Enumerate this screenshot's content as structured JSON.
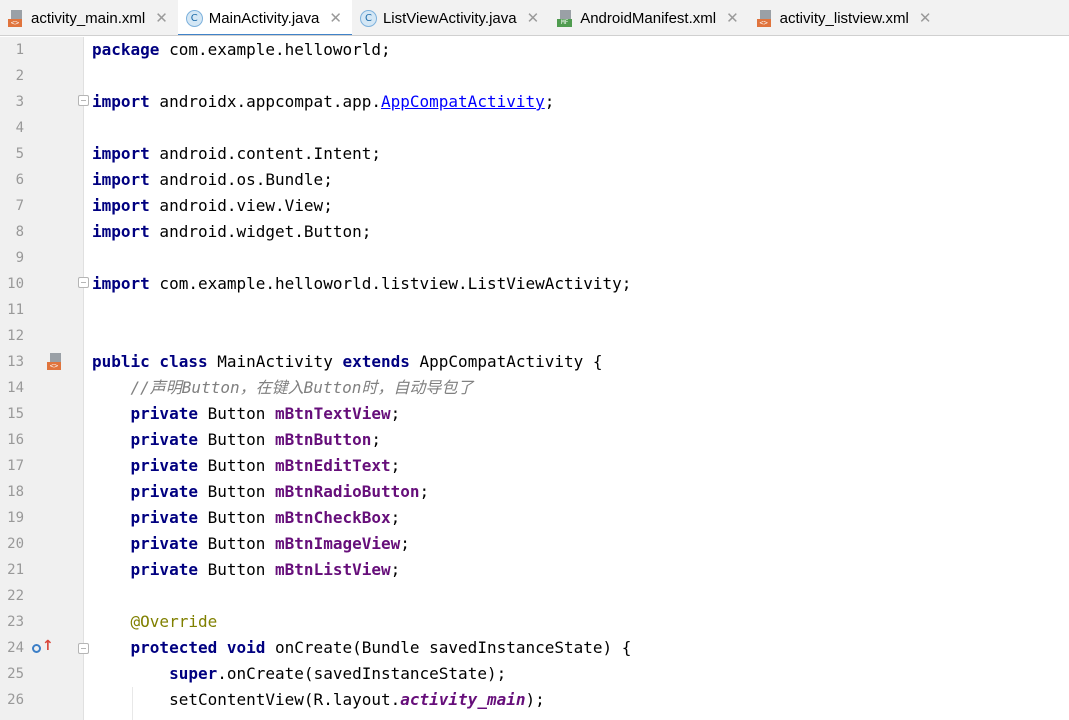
{
  "tabs": [
    {
      "label": "activity_main.xml",
      "icon": "xml-file-icon",
      "active": false
    },
    {
      "label": "MainActivity.java",
      "icon": "java-class-icon",
      "active": true
    },
    {
      "label": "ListViewActivity.java",
      "icon": "java-class-icon",
      "active": false
    },
    {
      "label": "AndroidManifest.xml",
      "icon": "manifest-file-icon",
      "active": false
    },
    {
      "label": "activity_listview.xml",
      "icon": "xml-file-icon",
      "active": false
    }
  ],
  "tab_close_glyph": "✕",
  "icon_badges": {
    "xml": "<>",
    "class": "C",
    "manifest": "MF"
  },
  "editor": {
    "lines": [
      {
        "n": "1",
        "tokens": [
          [
            "kw",
            "package"
          ],
          [
            "t",
            " com.example.helloworld;"
          ]
        ]
      },
      {
        "n": "2",
        "tokens": []
      },
      {
        "n": "3",
        "tokens": [
          [
            "kw",
            "import"
          ],
          [
            "t",
            " androidx.appcompat.app."
          ],
          [
            "link",
            "AppCompatActivity"
          ],
          [
            "t",
            ";"
          ]
        ]
      },
      {
        "n": "4",
        "tokens": []
      },
      {
        "n": "5",
        "tokens": [
          [
            "kw",
            "import"
          ],
          [
            "t",
            " android.content.Intent;"
          ]
        ]
      },
      {
        "n": "6",
        "tokens": [
          [
            "kw",
            "import"
          ],
          [
            "t",
            " android.os.Bundle;"
          ]
        ]
      },
      {
        "n": "7",
        "tokens": [
          [
            "kw",
            "import"
          ],
          [
            "t",
            " android.view.View;"
          ]
        ]
      },
      {
        "n": "8",
        "tokens": [
          [
            "kw",
            "import"
          ],
          [
            "t",
            " android.widget.Button;"
          ]
        ]
      },
      {
        "n": "9",
        "tokens": []
      },
      {
        "n": "10",
        "tokens": [
          [
            "kw",
            "import"
          ],
          [
            "t",
            " com.example.helloworld.listview.ListViewActivity;"
          ]
        ]
      },
      {
        "n": "11",
        "tokens": []
      },
      {
        "n": "12",
        "tokens": []
      },
      {
        "n": "13",
        "tokens": [
          [
            "kw",
            "public class"
          ],
          [
            "t",
            " MainActivity "
          ],
          [
            "kw",
            "extends"
          ],
          [
            "t",
            " AppCompatActivity {"
          ]
        ]
      },
      {
        "n": "14",
        "tokens": [
          [
            "t",
            "    "
          ],
          [
            "comment",
            "//声明Button，在键入Button时，自动导包了"
          ]
        ]
      },
      {
        "n": "15",
        "tokens": [
          [
            "t",
            "    "
          ],
          [
            "kw",
            "private"
          ],
          [
            "t",
            " Button "
          ],
          [
            "field",
            "mBtnTextView"
          ],
          [
            "t",
            ";"
          ]
        ]
      },
      {
        "n": "16",
        "tokens": [
          [
            "t",
            "    "
          ],
          [
            "kw",
            "private"
          ],
          [
            "t",
            " Button "
          ],
          [
            "field",
            "mBtnButton"
          ],
          [
            "t",
            ";"
          ]
        ]
      },
      {
        "n": "17",
        "tokens": [
          [
            "t",
            "    "
          ],
          [
            "kw",
            "private"
          ],
          [
            "t",
            " Button "
          ],
          [
            "field",
            "mBtnEditText"
          ],
          [
            "t",
            ";"
          ]
        ]
      },
      {
        "n": "18",
        "tokens": [
          [
            "t",
            "    "
          ],
          [
            "kw",
            "private"
          ],
          [
            "t",
            " Button "
          ],
          [
            "field",
            "mBtnRadioButton"
          ],
          [
            "t",
            ";"
          ]
        ]
      },
      {
        "n": "19",
        "tokens": [
          [
            "t",
            "    "
          ],
          [
            "kw",
            "private"
          ],
          [
            "t",
            " Button "
          ],
          [
            "field",
            "mBtnCheckBox"
          ],
          [
            "t",
            ";"
          ]
        ]
      },
      {
        "n": "20",
        "tokens": [
          [
            "t",
            "    "
          ],
          [
            "kw",
            "private"
          ],
          [
            "t",
            " Button "
          ],
          [
            "field",
            "mBtnImageView"
          ],
          [
            "t",
            ";"
          ]
        ]
      },
      {
        "n": "21",
        "tokens": [
          [
            "t",
            "    "
          ],
          [
            "kw",
            "private"
          ],
          [
            "t",
            " Button "
          ],
          [
            "field",
            "mBtnListView"
          ],
          [
            "t",
            ";"
          ]
        ]
      },
      {
        "n": "22",
        "tokens": []
      },
      {
        "n": "23",
        "tokens": [
          [
            "t",
            "    "
          ],
          [
            "annot",
            "@Override"
          ]
        ]
      },
      {
        "n": "24",
        "tokens": [
          [
            "t",
            "    "
          ],
          [
            "kw",
            "protected void"
          ],
          [
            "t",
            " onCreate(Bundle savedInstanceState) {"
          ]
        ]
      },
      {
        "n": "25",
        "tokens": [
          [
            "t",
            "        "
          ],
          [
            "kw",
            "super"
          ],
          [
            "t",
            ".onCreate(savedInstanceState);"
          ]
        ]
      },
      {
        "n": "26",
        "tokens": [
          [
            "t",
            "        setContentView(R.layout."
          ],
          [
            "italic-field",
            "activity_main"
          ],
          [
            "t",
            ");"
          ]
        ]
      }
    ]
  }
}
